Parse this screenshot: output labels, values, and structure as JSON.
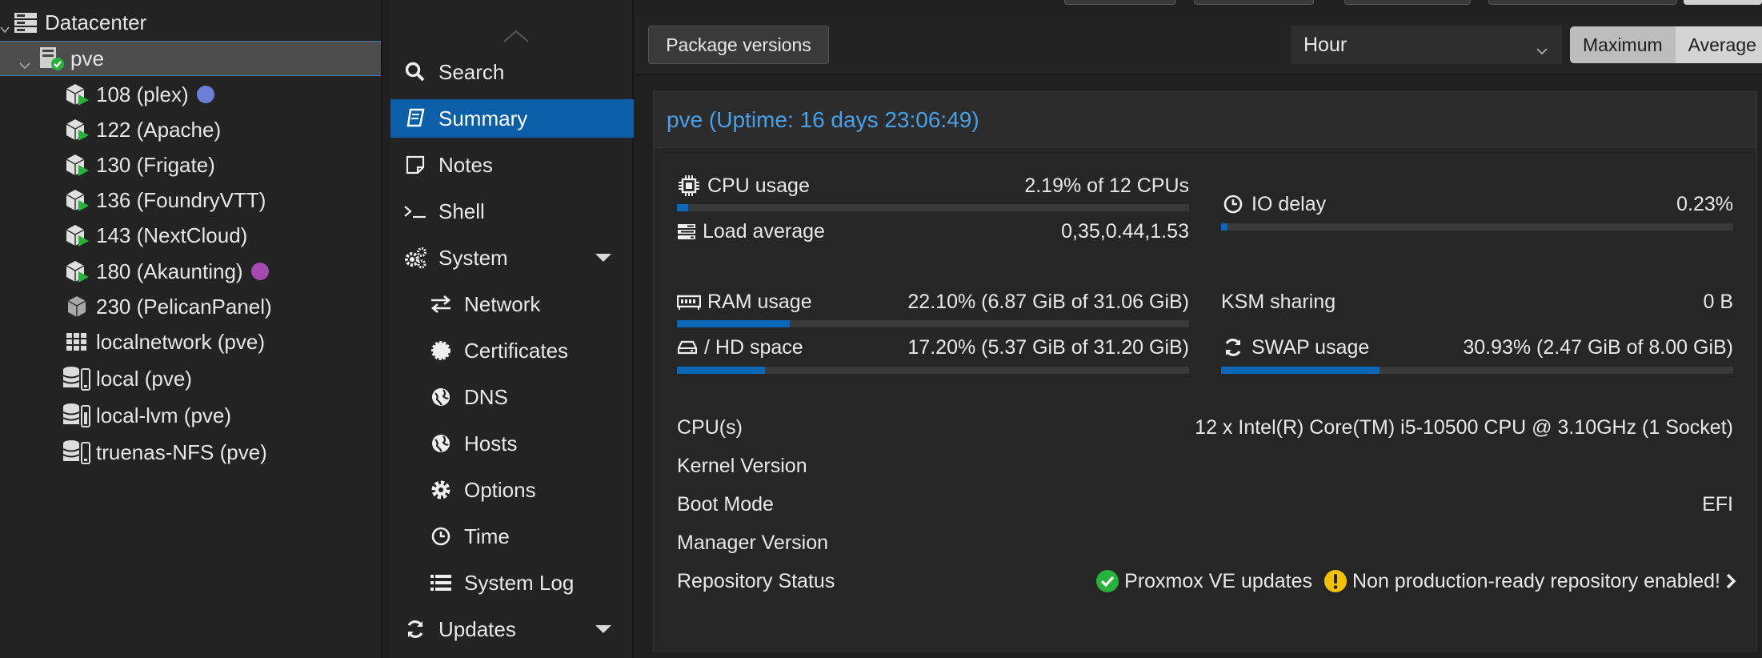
{
  "tree": {
    "datacenter": "Datacenter",
    "node": "pve",
    "items": [
      {
        "label": "108 (plex)",
        "type": "ct-running",
        "tag_color": "#6b7fd4"
      },
      {
        "label": "122 (Apache)",
        "type": "ct-running"
      },
      {
        "label": "130 (Frigate)",
        "type": "ct-running"
      },
      {
        "label": "136 (FoundryVTT)",
        "type": "ct-running"
      },
      {
        "label": "143 (NextCloud)",
        "type": "ct-running"
      },
      {
        "label": "180 (Akaunting)",
        "type": "ct-running",
        "tag_color": "#a64ab0"
      },
      {
        "label": "230 (PelicanPanel)",
        "type": "ct-stopped"
      },
      {
        "label": "localnetwork (pve)",
        "type": "sdn"
      },
      {
        "label": "local (pve)",
        "type": "storage"
      },
      {
        "label": "local-lvm (pve)",
        "type": "storage"
      },
      {
        "label": "truenas-NFS (pve)",
        "type": "storage"
      }
    ]
  },
  "nav": {
    "items": [
      {
        "label": "Search",
        "icon": "search-icon"
      },
      {
        "label": "Summary",
        "icon": "book-icon",
        "active": true
      },
      {
        "label": "Notes",
        "icon": "note-icon"
      },
      {
        "label": "Shell",
        "icon": "terminal-icon"
      },
      {
        "label": "System",
        "icon": "gears-icon",
        "expandable": true
      },
      {
        "label": "Network",
        "icon": "exchange-icon",
        "sub": true
      },
      {
        "label": "Certificates",
        "icon": "certificate-icon",
        "sub": true
      },
      {
        "label": "DNS",
        "icon": "globe-icon",
        "sub": true
      },
      {
        "label": "Hosts",
        "icon": "globe-icon",
        "sub": true
      },
      {
        "label": "Options",
        "icon": "gear-icon",
        "sub": true
      },
      {
        "label": "Time",
        "icon": "clock-icon",
        "sub": true
      },
      {
        "label": "System Log",
        "icon": "list-icon",
        "sub": true
      },
      {
        "label": "Updates",
        "icon": "refresh-icon",
        "expandable": true
      }
    ]
  },
  "toolbar": {
    "package_versions": "Package versions",
    "timeframe": "Hour",
    "consolidation": [
      "Maximum",
      "Average"
    ]
  },
  "summary": {
    "title": "pve (Uptime: 16 days 23:06:49)",
    "cpu": {
      "label": "CPU usage",
      "value": "2.19% of 12 CPUs",
      "fraction": 0.0219
    },
    "load": {
      "label": "Load average",
      "value": "0,35,0.44,1.53"
    },
    "io": {
      "label": "IO delay",
      "value": "0.23%",
      "fraction": 0.0023
    },
    "ram": {
      "label": "RAM usage",
      "value": "22.10% (6.87 GiB of 31.06 GiB)",
      "fraction": 0.221
    },
    "ksm": {
      "label": "KSM sharing",
      "value": "0 B"
    },
    "hd": {
      "label": "/ HD space",
      "value": "17.20% (5.37 GiB of 31.20 GiB)",
      "fraction": 0.172
    },
    "swap": {
      "label": "SWAP usage",
      "value": "30.93% (2.47 GiB of 8.00 GiB)",
      "fraction": 0.3093
    },
    "cpus": {
      "label": "CPU(s)",
      "value": "12 x Intel(R) Core(TM) i5-10500 CPU @ 3.10GHz (1 Socket)"
    },
    "kernel": {
      "label": "Kernel Version",
      "value": ""
    },
    "boot": {
      "label": "Boot Mode",
      "value": "EFI"
    },
    "manager": {
      "label": "Manager Version",
      "value": ""
    },
    "repo": {
      "label": "Repository Status",
      "ok": "Proxmox VE updates",
      "warn": "Non production-ready repository enabled!"
    }
  },
  "colors": {
    "accent": "#0a5fa8",
    "title": "#47a0e8",
    "ok": "#27b33b",
    "warn": "#f2c100"
  }
}
